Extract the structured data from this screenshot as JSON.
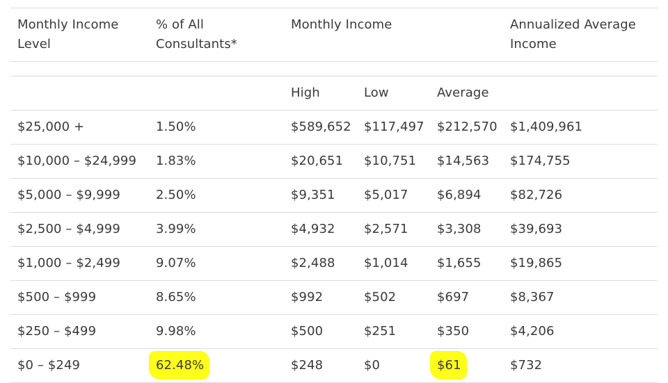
{
  "table": {
    "headers": {
      "income_level": [
        "Monthly Income",
        "Level"
      ],
      "percent": [
        "% of All",
        "Consultants*"
      ],
      "monthly_income": "Monthly Income",
      "annualized": [
        "Annualized Average",
        "Income"
      ]
    },
    "subheaders": {
      "high": "High",
      "low": "Low",
      "average": "Average"
    },
    "rows": [
      {
        "level": "$25,000 +",
        "percent": "1.50%",
        "high": "$589,652",
        "low": "$117,497",
        "average": "$212,570",
        "annual": "$1,409,961"
      },
      {
        "level": "$10,000 – $24,999",
        "percent": "1.83%",
        "high": "$20,651",
        "low": "$10,751",
        "average": "$14,563",
        "annual": "$174,755"
      },
      {
        "level": "$5,000 – $9,999",
        "percent": "2.50%",
        "high": "$9,351",
        "low": "$5,017",
        "average": "$6,894",
        "annual": "$82,726"
      },
      {
        "level": "$2,500 – $4,999",
        "percent": "3.99%",
        "high": "$4,932",
        "low": "$2,571",
        "average": "$3,308",
        "annual": "$39,693"
      },
      {
        "level": "$1,000 – $2,499",
        "percent": "9.07%",
        "high": "$2,488",
        "low": "$1,014",
        "average": "$1,655",
        "annual": "$19,865"
      },
      {
        "level": "$500 – $999",
        "percent": "8.65%",
        "high": "$992",
        "low": "$502",
        "average": "$697",
        "annual": "$8,367"
      },
      {
        "level": "$250 – $499",
        "percent": "9.98%",
        "high": "$500",
        "low": "$251",
        "average": "$350",
        "annual": "$4,206"
      },
      {
        "level": "$0 – $249",
        "percent": "62.48%",
        "high": "$248",
        "low": "$0",
        "average": "$61",
        "annual": "$732"
      }
    ],
    "highlighted_cells": [
      "rows.7.percent",
      "rows.7.average"
    ],
    "highlight_color": "#ffff1a"
  }
}
